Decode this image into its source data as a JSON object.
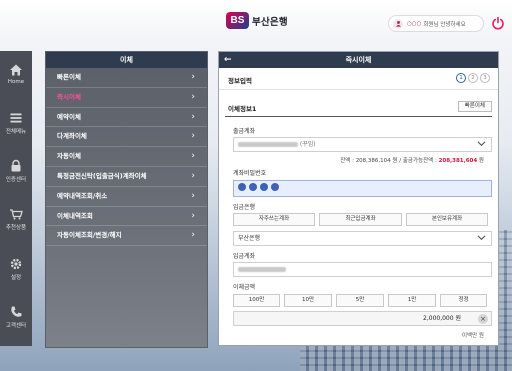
{
  "header": {
    "logo_mark": "BS",
    "logo_text": "부산은행",
    "user_name": "○○○",
    "user_greeting": "회원님 안녕하세요",
    "accent": "#c0174c",
    "power_icon": "power-icon"
  },
  "leftnav": {
    "items": [
      {
        "label": "Home",
        "icon": "home-icon"
      },
      {
        "label": "전체메뉴",
        "icon": "menu-icon"
      },
      {
        "label": "인증센터",
        "icon": "lock-icon"
      },
      {
        "label": "추천상품",
        "icon": "basket-icon"
      },
      {
        "label": "설정",
        "icon": "gear-icon"
      },
      {
        "label": "고객센터",
        "icon": "phone-icon"
      }
    ]
  },
  "menu": {
    "title": "이체",
    "items": [
      {
        "label": "빠른이체",
        "active": false
      },
      {
        "label": "즉시이체",
        "active": true
      },
      {
        "label": "예약이체",
        "active": false
      },
      {
        "label": "다계좌이체",
        "active": false
      },
      {
        "label": "자동이체",
        "active": false
      },
      {
        "label": "특정금전신탁(입출금식)계좌이체",
        "active": false
      },
      {
        "label": "예약내역조회/취소",
        "active": false
      },
      {
        "label": "이체내역조회",
        "active": false
      },
      {
        "label": "자동이체조회/변경/해지",
        "active": false
      }
    ]
  },
  "main": {
    "title": "즉시이체",
    "step_label": "정보입력",
    "steps": [
      "1",
      "2",
      "3"
    ],
    "current_step": 1,
    "section_title": "이체정보1",
    "quick_transfer_button": "빠른이체",
    "withdraw_label": "출금계좌",
    "withdraw_suffix": "(꾸밈)",
    "balance_prefix": "잔액 : ",
    "balance": "208,386,104",
    "withdrawable_prefix": " 원 / 출금가능잔액 : ",
    "withdrawable": "208,381,604",
    "won": " 원",
    "password_label": "계좌비밀번호",
    "bank_label": "입금은행",
    "bank_buttons": [
      "자주쓰는계좌",
      "최근입금계좌",
      "본인보유계좌"
    ],
    "bank_selected": "부산은행",
    "deposit_label": "입금계좌",
    "amount_label": "이체금액",
    "amount_buttons": [
      "100만",
      "10만",
      "5만",
      "1만",
      "정정"
    ],
    "amount_value": "2,000,000 원",
    "amount_clear": "×",
    "amount_hangul": "이백만 원"
  }
}
